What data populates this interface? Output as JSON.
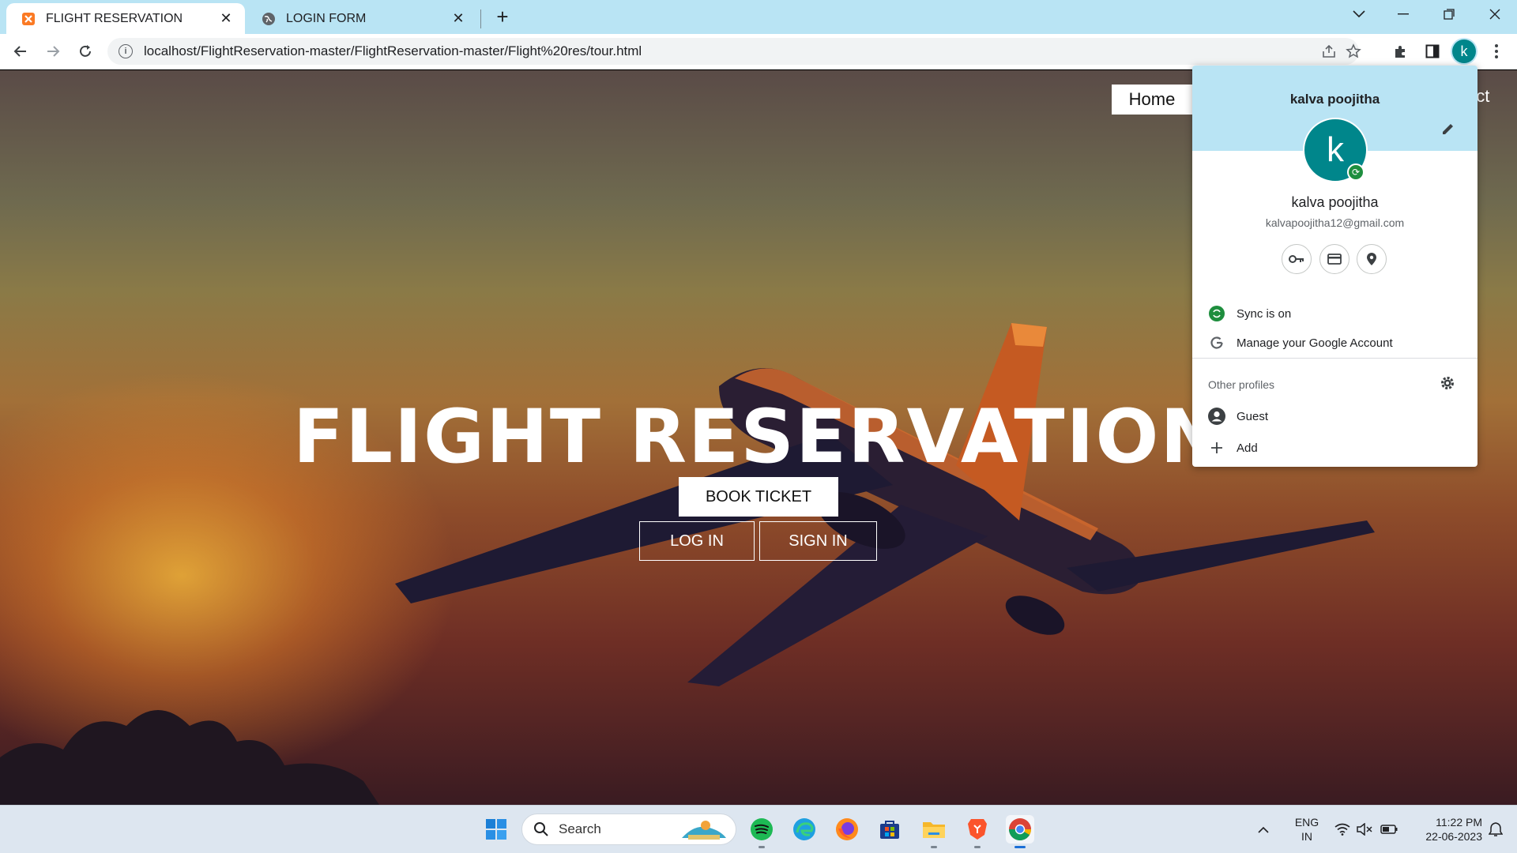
{
  "browser": {
    "tabs": [
      {
        "title": "FLIGHT RESERVATION",
        "favicon": "xampp-icon",
        "active": true
      },
      {
        "title": "LOGIN FORM",
        "favicon": "globe-icon",
        "active": false
      }
    ],
    "url": "localhost/FlightReservation-master/FlightReservation-master/Flight%20res/tour.html",
    "profile_initial": "k"
  },
  "site": {
    "nav": {
      "home": "Home",
      "contact_partial": "act"
    },
    "hero_title": "FLIGHT RESERVATION",
    "buttons": {
      "book": "BOOK TICKET",
      "login": "LOG IN",
      "signin": "SIGN IN"
    }
  },
  "profile_menu": {
    "header_name": "kalva poojitha",
    "avatar_initial": "k",
    "name": "kalva poojitha",
    "email": "kalvapoojitha12@gmail.com",
    "quick_icons": [
      "key-icon",
      "card-icon",
      "location-pin-icon"
    ],
    "sync": "Sync is on",
    "manage": "Manage your Google Account",
    "other_profiles_label": "Other profiles",
    "guest": "Guest",
    "add": "Add"
  },
  "taskbar": {
    "search_placeholder": "Search",
    "apps": [
      "windows-start-icon",
      "spotify-icon",
      "edge-icon",
      "firefox-icon",
      "store-icon",
      "file-explorer-icon",
      "brave-icon",
      "chrome-icon"
    ],
    "lang_top": "ENG",
    "lang_bottom": "IN",
    "time": "11:22 PM",
    "date": "22-06-2023"
  },
  "colors": {
    "tabstrip": "#b9e4f4",
    "avatar": "#00868b",
    "sync_green": "#1e8e3e"
  }
}
